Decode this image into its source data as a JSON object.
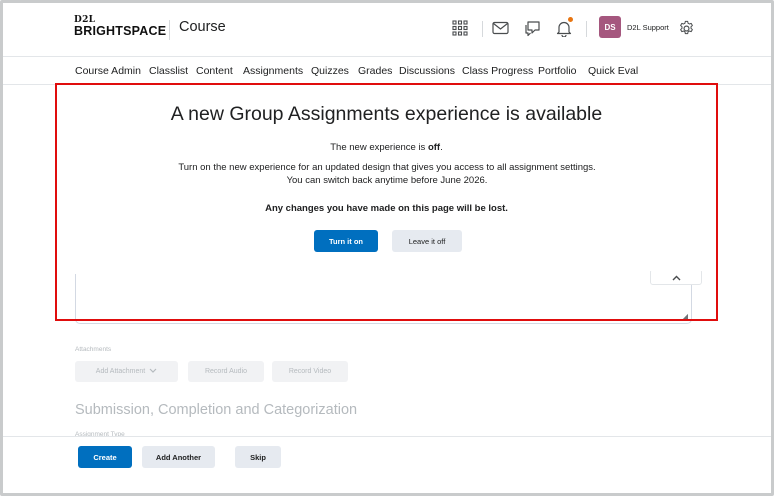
{
  "header": {
    "logo_top": "D2L",
    "logo_bottom": "BRIGHTSPACE",
    "course_title": "Course",
    "avatar_initials": "DS",
    "user_name": "D2L Support",
    "icons": [
      "apps-grid-icon",
      "mail-icon",
      "chat-icon",
      "bell-icon",
      "gear-icon"
    ],
    "avatar_color": "#a5577e"
  },
  "nav": {
    "items": [
      "Course Admin",
      "Classlist",
      "Content",
      "Assignments",
      "Quizzes",
      "Grades",
      "Discussions",
      "Class Progress",
      "Portfolio",
      "Quick Eval"
    ]
  },
  "dialog": {
    "title": "A new Group Assignments experience is available",
    "status_prefix": "The new experience is ",
    "status_value": "off",
    "status_suffix": ".",
    "description": "Turn on the new experience for an updated design that gives you access to all assignment settings. You can switch back anytime before June 2026.",
    "warning": "Any changes you have made on this page will be lost.",
    "turn_on_label": "Turn it on",
    "leave_off_label": "Leave it off"
  },
  "background": {
    "attachments_label": "Attachments",
    "add_attachment_label": "Add Attachment",
    "record_audio_label": "Record Audio",
    "record_video_label": "Record Video",
    "section_heading": "Submission, Completion and Categorization",
    "assignment_type_label": "Assignment Type"
  },
  "footer": {
    "create_label": "Create",
    "add_another_label": "Add Another",
    "skip_label": "Skip"
  },
  "colors": {
    "primary": "#006fbf",
    "highlight": "#e00d0d",
    "notification": "#e87511"
  }
}
